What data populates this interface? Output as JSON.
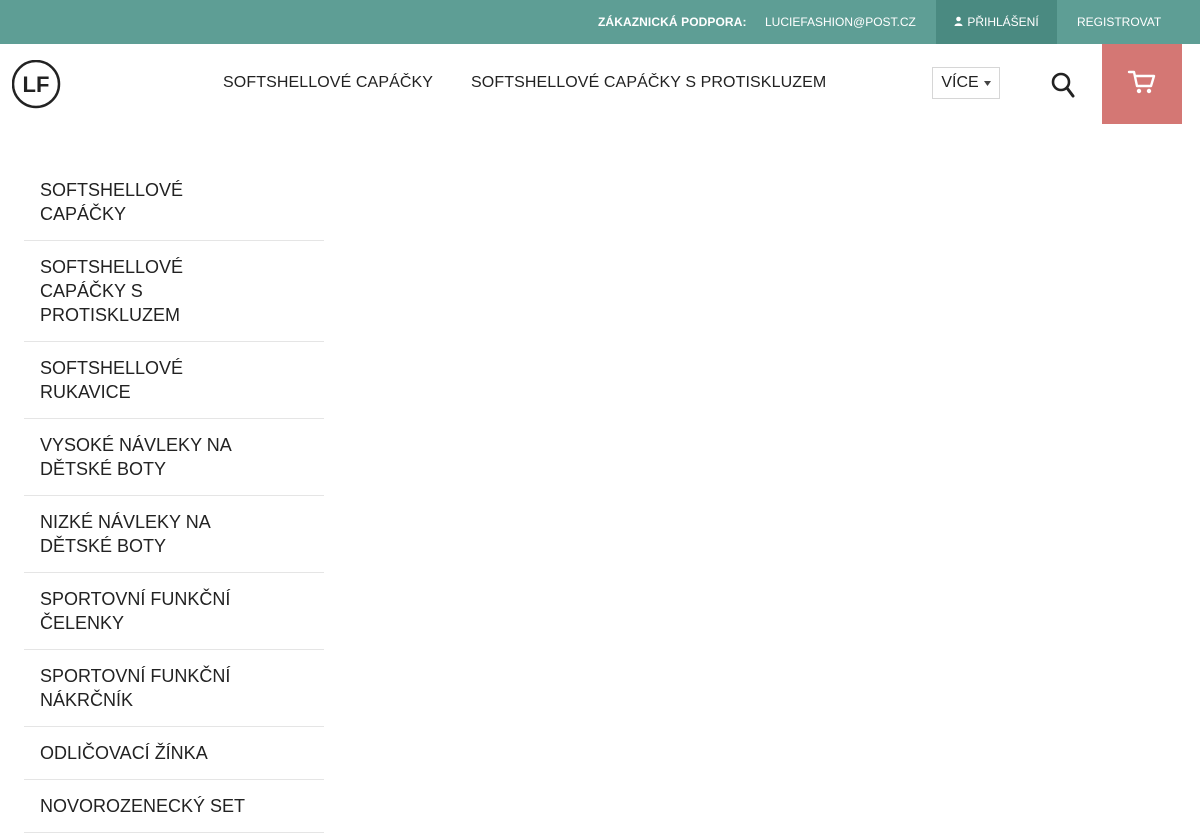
{
  "topbar": {
    "support_label": "ZÁKAZNICKÁ PODPORA:",
    "email": "LUCIEFASHION@POST.CZ",
    "login_label": "PŘIHLÁŠENÍ",
    "login_icon": "user-icon",
    "register_label": "REGISTROVAT",
    "bg_color": "#5e9e95"
  },
  "header": {
    "logo_text": "LF",
    "nav": [
      {
        "label": "SOFTSHELLOVÉ CAPÁČKY"
      },
      {
        "label": "SOFTSHELLOVÉ CAPÁČKY S PROTISKLUZEM"
      }
    ],
    "more_label": "VÍCE",
    "search_icon": "search-icon",
    "cart_icon": "cart-icon",
    "cart_color": "#d47774"
  },
  "sidebar": {
    "items": [
      {
        "label": "SOFTSHELLOVÉ CAPÁČKY"
      },
      {
        "label": "SOFTSHELLOVÉ CAPÁČKY S PROTISKLUZEM"
      },
      {
        "label": "SOFTSHELLOVÉ RUKAVICE"
      },
      {
        "label": "VYSOKÉ NÁVLEKY NA DĚTSKÉ BOTY"
      },
      {
        "label": "NIZKÉ NÁVLEKY NA DĚTSKÉ BOTY"
      },
      {
        "label": "SPORTOVNÍ FUNKČNÍ ČELENKY"
      },
      {
        "label": "SPORTOVNÍ FUNKČNÍ NÁKRČNÍK"
      },
      {
        "label": "ODLIČOVACÍ ŽÍNKA"
      },
      {
        "label": "NOVOROZENECKÝ SET"
      }
    ]
  }
}
